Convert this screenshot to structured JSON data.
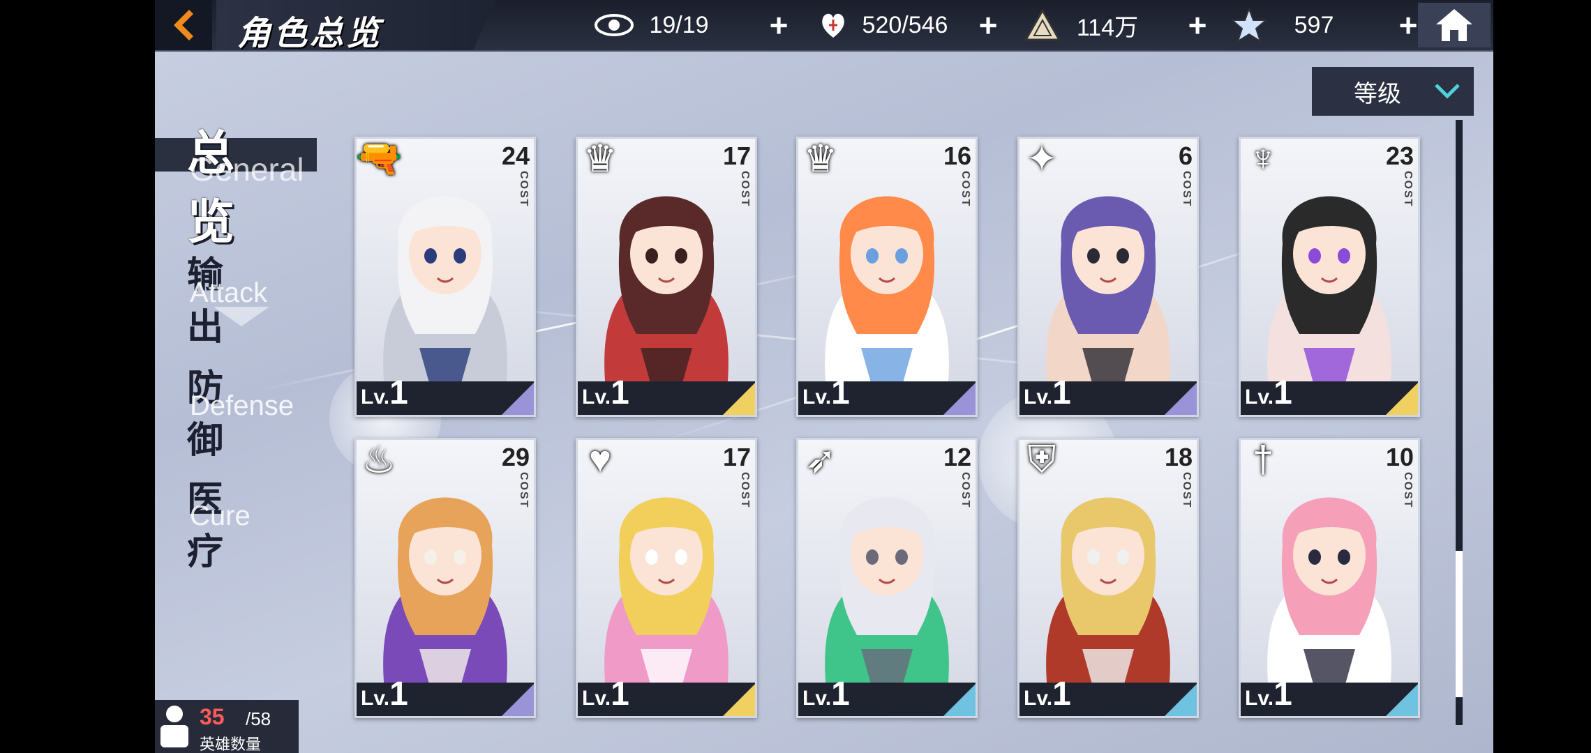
{
  "header": {
    "title": "角色总览",
    "resources": [
      {
        "icon": "eye-icon",
        "value": "19/19"
      },
      {
        "icon": "stamina-heart-icon",
        "value": "520/546"
      },
      {
        "icon": "triangle-coin-icon",
        "value": "114万"
      },
      {
        "icon": "star-crystal-icon",
        "value": "597"
      }
    ]
  },
  "sort": {
    "label": "等级"
  },
  "tabs": [
    {
      "cn": "总览",
      "en": "General"
    },
    {
      "cn": "输出",
      "en": "Attack"
    },
    {
      "cn": "防御",
      "en": "Defense"
    },
    {
      "cn": "医疗",
      "en": "Cure"
    }
  ],
  "card_common": {
    "cost_label": "COST",
    "level_prefix": "Lv."
  },
  "cards": [
    {
      "cost": "24",
      "level": "1",
      "class_icon": "gun-icon",
      "rarity_color": "#9b93d8"
    },
    {
      "cost": "17",
      "level": "1",
      "class_icon": "crown-sword-icon",
      "rarity_color": "#f0d060"
    },
    {
      "cost": "16",
      "level": "1",
      "class_icon": "crown-sword-icon",
      "rarity_color": "#9b93d8"
    },
    {
      "cost": "6",
      "level": "1",
      "class_icon": "shuriken-icon",
      "rarity_color": "#9b93d8"
    },
    {
      "cost": "23",
      "level": "1",
      "class_icon": "demon-mask-icon",
      "rarity_color": "#f0d060"
    },
    {
      "cost": "29",
      "level": "1",
      "class_icon": "flame-icon",
      "rarity_color": "#9b93d8"
    },
    {
      "cost": "17",
      "level": "1",
      "class_icon": "heart-wing-icon",
      "rarity_color": "#f0d060"
    },
    {
      "cost": "12",
      "level": "1",
      "class_icon": "bow-icon",
      "rarity_color": "#6fc3e0"
    },
    {
      "cost": "18",
      "level": "1",
      "class_icon": "shield-icon",
      "rarity_color": "#6fc3e0"
    },
    {
      "cost": "10",
      "level": "1",
      "class_icon": "sword-icon",
      "rarity_color": "#6fc3e0"
    }
  ],
  "hero_count": {
    "current": "35",
    "max": "/58",
    "label": "英雄数量"
  }
}
